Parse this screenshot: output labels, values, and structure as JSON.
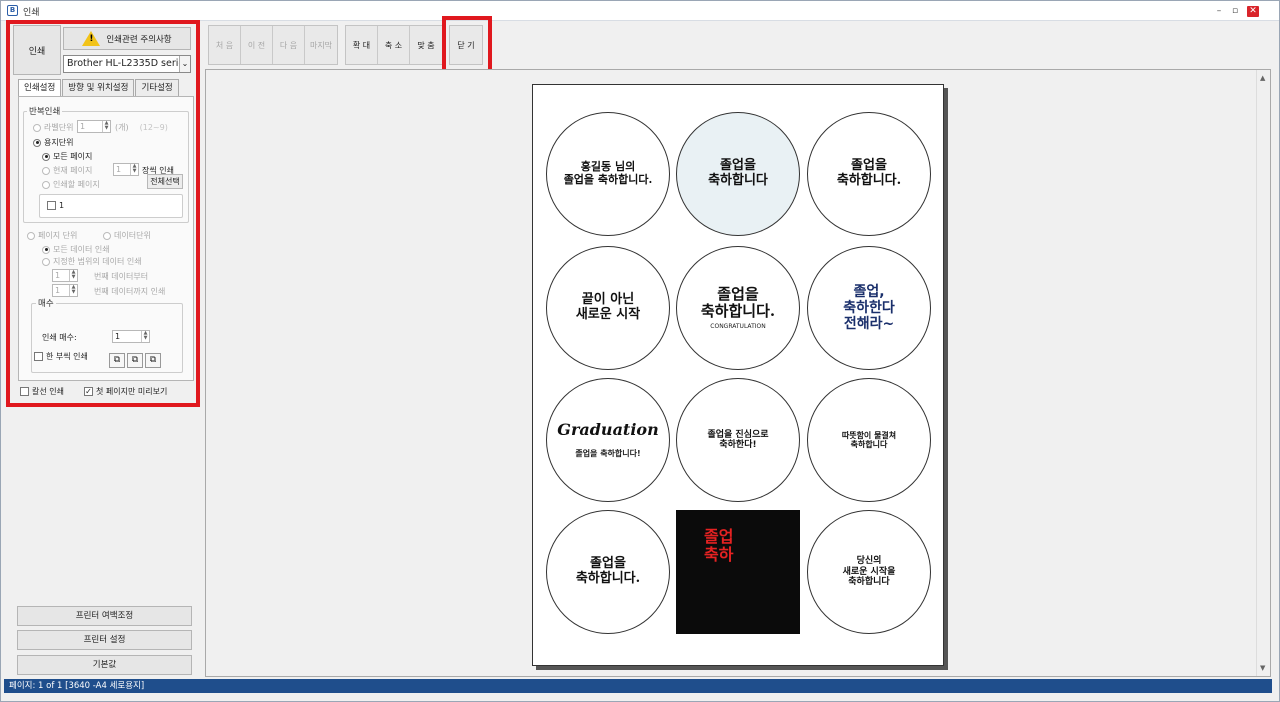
{
  "window": {
    "title": "인쇄",
    "app_icon_text": "B",
    "controls": {
      "minimize": "–",
      "restore": "▫",
      "close": "✕"
    }
  },
  "left_panel": {
    "print_button": "인쇄",
    "warning_button": "인쇄관련 주의사항",
    "printer_select": "Brother HL-L2335D series(",
    "tabs": [
      {
        "label": "인쇄설정",
        "active": true
      },
      {
        "label": "방향 및 위치설정",
        "active": false
      },
      {
        "label": "기타설정",
        "active": false
      }
    ],
    "repeat_group": {
      "title": "반복인쇄",
      "label_unit": "라벨단위",
      "label_unit_value": "1",
      "label_unit_suffix": "(개)",
      "label_unit_range": "(12~9)",
      "paper_unit": "용지단위",
      "all_pages": "모든 페이지",
      "current_page": "현재 페이지",
      "current_page_value": "1",
      "current_page_suffix": "장씩 인쇄",
      "pages_to_print": "인쇄할 페이지",
      "select_all": "전체선택",
      "page_item": "1"
    },
    "data_group": {
      "page_unit": "페이지 단위",
      "data_unit": "데이터단위",
      "all_data": "모든 데이터 인쇄",
      "range_data": "지정한 범위의 데이터 인쇄",
      "from_value": "1",
      "from_suffix": "번째 데이터부터",
      "to_value": "1",
      "to_suffix": "번째 데이터까지 인쇄"
    },
    "copies_group": {
      "title": "매수",
      "copies_label": "인쇄 매수:",
      "copies_value": "1",
      "collate": "한 부씩 인쇄"
    },
    "cut_line": "칼선 인쇄",
    "first_page_preview": "첫 페이지만 미리보기",
    "buttons": {
      "margin": "프린터 여백조정",
      "printer_settings": "프린터 설정",
      "defaults": "기본값"
    }
  },
  "toolbar": {
    "nav": [
      "처 음",
      "이 전",
      "다 음",
      "마지막"
    ],
    "zoom": [
      "확 대",
      "축 소",
      "맞 춤"
    ],
    "close": "닫 기"
  },
  "preview": {
    "stickers": [
      {
        "text": "홍길동 님의\n졸업을 축하합니다."
      },
      {
        "text": "졸업을\n축하합니다"
      },
      {
        "text": "졸업을\n축하합니다."
      },
      {
        "text": "끝이 아닌\n새로운 시작"
      },
      {
        "text": "졸업을\n축하합니다.",
        "sub": "CONGRATULATION"
      },
      {
        "text": "졸업,\n축하한다\n전해라~"
      },
      {
        "text": "Graduation",
        "sub": "졸업을 축하합니다!"
      },
      {
        "text": "졸업을 진심으로\n축하한다!"
      },
      {
        "text": "따뜻함이 물결쳐\n축하합니다"
      },
      {
        "text": "졸업을\n축하합니다."
      },
      {
        "text": "졸업\n축하"
      },
      {
        "text": "당신의\n새로운 시작을\n축하합니다"
      }
    ]
  },
  "status": "페이지: 1 of 1 [3640 -A4 세로용지]",
  "colors": {
    "highlight": "#e0181e",
    "status_bar": "#1f4e8c",
    "warning": "#f2c318"
  }
}
